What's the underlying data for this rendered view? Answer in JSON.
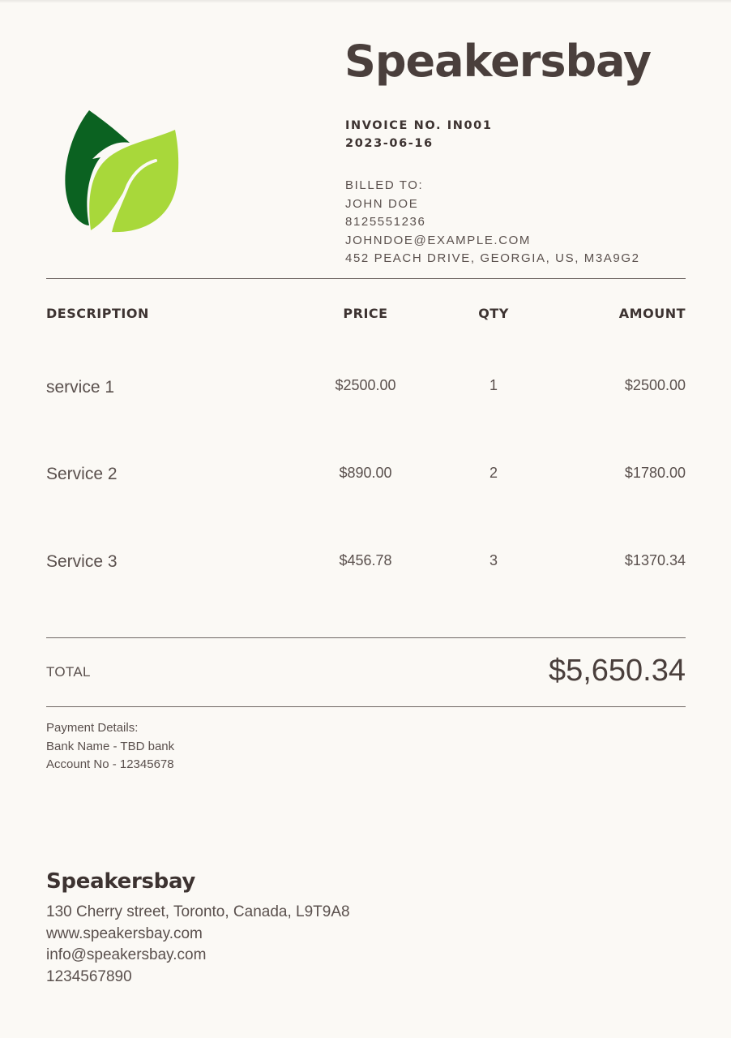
{
  "company": {
    "name": "Speakersbay",
    "address": "130 Cherry street, Toronto, Canada, L9T9A8",
    "website": "www.speakersbay.com",
    "email": "info@speakersbay.com",
    "phone": "1234567890"
  },
  "logo": {
    "icon": "leaf-logo-icon",
    "dark_leaf_color": "#0b6221",
    "light_leaf_color": "#a8d83a"
  },
  "invoice": {
    "number_label": "INVOICE NO. IN001",
    "date": "2023-06-16"
  },
  "billed_to": {
    "label": "BILLED TO:",
    "name": "JOHN DOE",
    "phone": "8125551236",
    "email": "JOHNDOE@EXAMPLE.COM",
    "address": "452 PEACH DRIVE, GEORGIA, US, M3A9G2"
  },
  "table": {
    "headers": {
      "description": "DESCRIPTION",
      "price": "PRICE",
      "qty": "QTY",
      "amount": "AMOUNT"
    },
    "rows": [
      {
        "description": "service 1",
        "price": "$2500.00",
        "qty": "1",
        "amount": "$2500.00"
      },
      {
        "description": "Service 2",
        "price": "$890.00",
        "qty": "2",
        "amount": "$1780.00"
      },
      {
        "description": "Service 3",
        "price": "$456.78",
        "qty": "3",
        "amount": "$1370.34"
      }
    ]
  },
  "total": {
    "label": "TOTAL",
    "value": "$5,650.34"
  },
  "payment": {
    "title": "Payment Details:",
    "bank": "Bank Name - TBD bank",
    "account": "Account No - 12345678"
  }
}
